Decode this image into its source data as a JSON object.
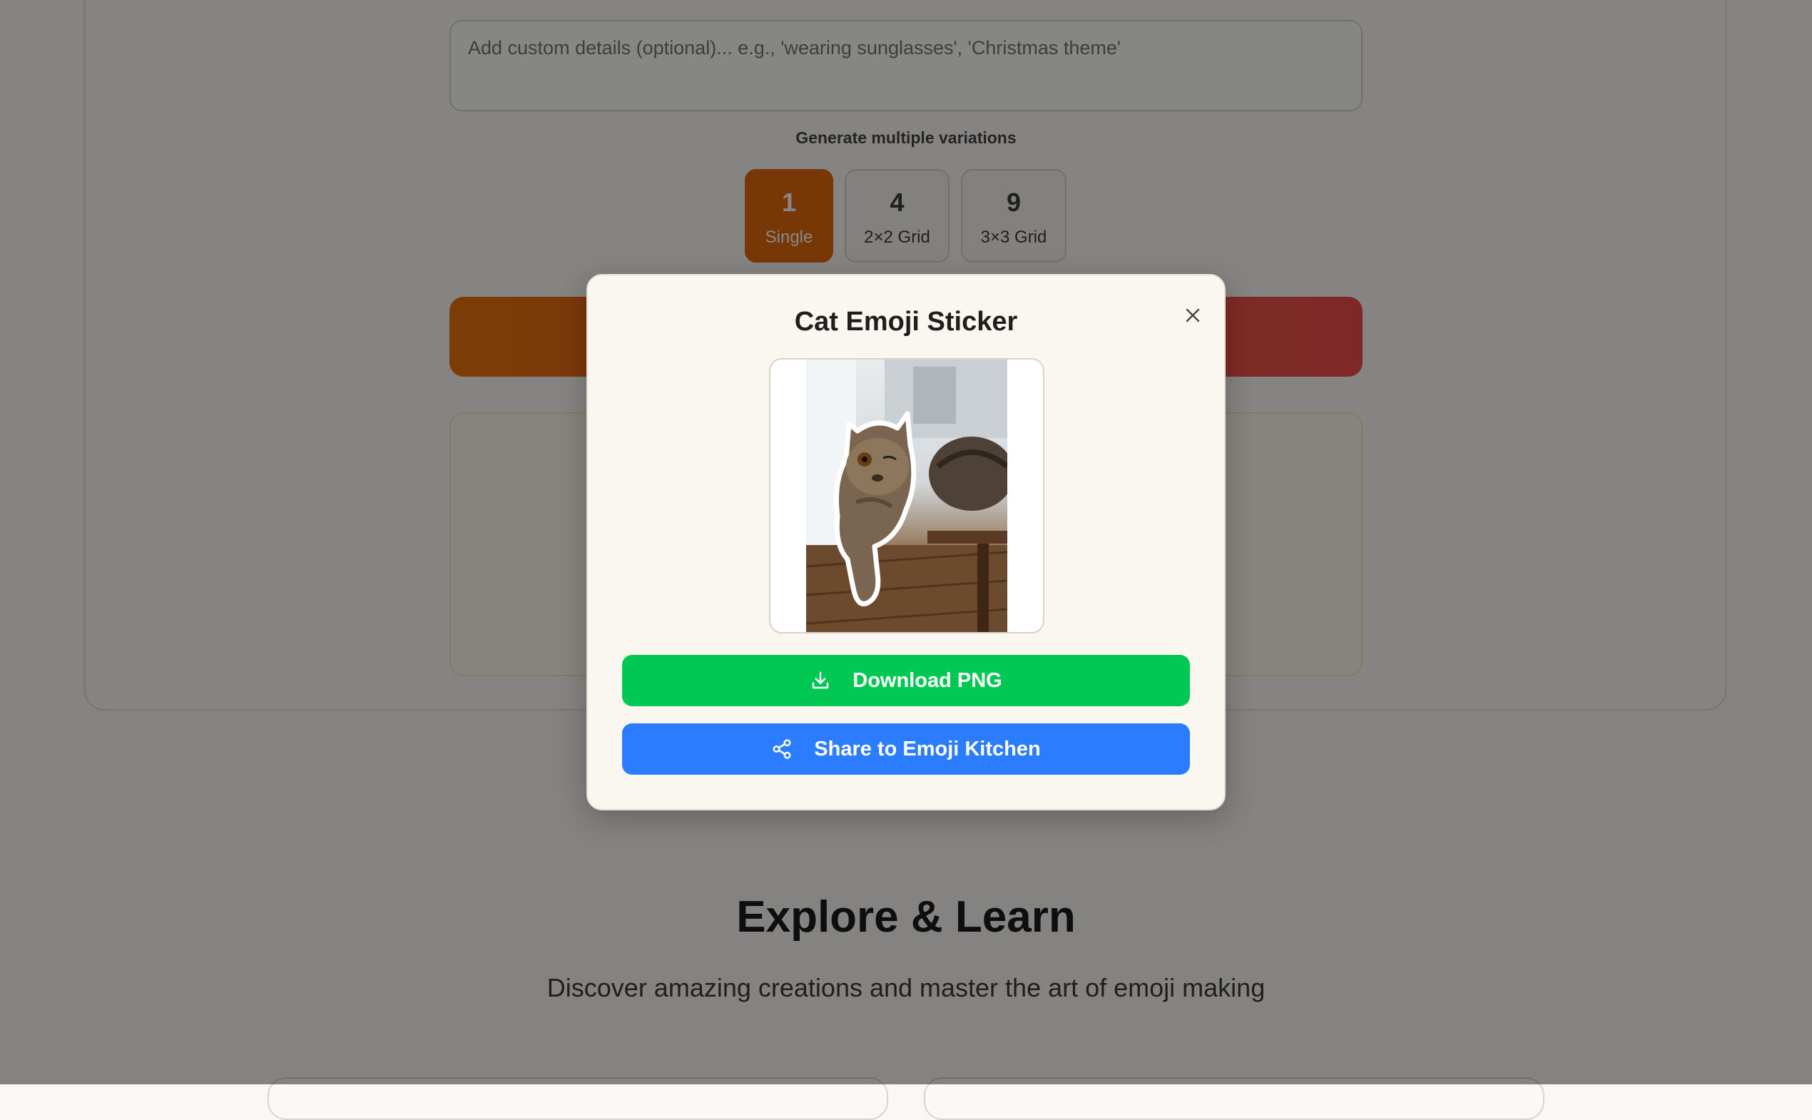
{
  "form": {
    "custom_details_placeholder": "Add custom details (optional)... e.g., 'wearing sunglasses', 'Christmas theme'",
    "variations_label": "Generate multiple variations",
    "variations": [
      {
        "count": "1",
        "label": "Single",
        "selected": true
      },
      {
        "count": "4",
        "label": "2×2 Grid",
        "selected": false
      },
      {
        "count": "9",
        "label": "3×3 Grid",
        "selected": false
      }
    ],
    "accent_color": "#e3680f"
  },
  "explore": {
    "title": "Explore & Learn",
    "subtitle": "Discover amazing creations and master the art of emoji making"
  },
  "modal": {
    "title": "Cat Emoji Sticker",
    "preview_alt": "cat sticker preview",
    "download_label": "Download PNG",
    "share_label": "Share to Emoji Kitchen",
    "download_color": "#00c853",
    "share_color": "#2b7cff",
    "icons": {
      "close": "close-icon",
      "download": "download-icon",
      "share": "share-icon"
    }
  }
}
